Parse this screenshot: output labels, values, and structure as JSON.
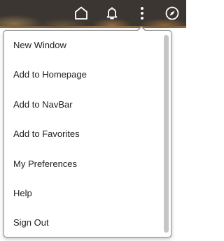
{
  "header": {
    "icons": [
      {
        "name": "home-icon"
      },
      {
        "name": "bell-icon"
      },
      {
        "name": "more-options-icon"
      },
      {
        "name": "compass-icon"
      }
    ],
    "icon_color": "#ffffff",
    "background_color": "#3b3632"
  },
  "actions_menu": {
    "items": [
      {
        "label": "New Window"
      },
      {
        "label": "Add to Homepage"
      },
      {
        "label": "Add to NavBar"
      },
      {
        "label": "Add to Favorites"
      },
      {
        "label": "My Preferences"
      },
      {
        "label": "Help"
      },
      {
        "label": "Sign Out"
      }
    ],
    "text_color": "#1f1f1f",
    "border_color": "#8f8f8f"
  }
}
